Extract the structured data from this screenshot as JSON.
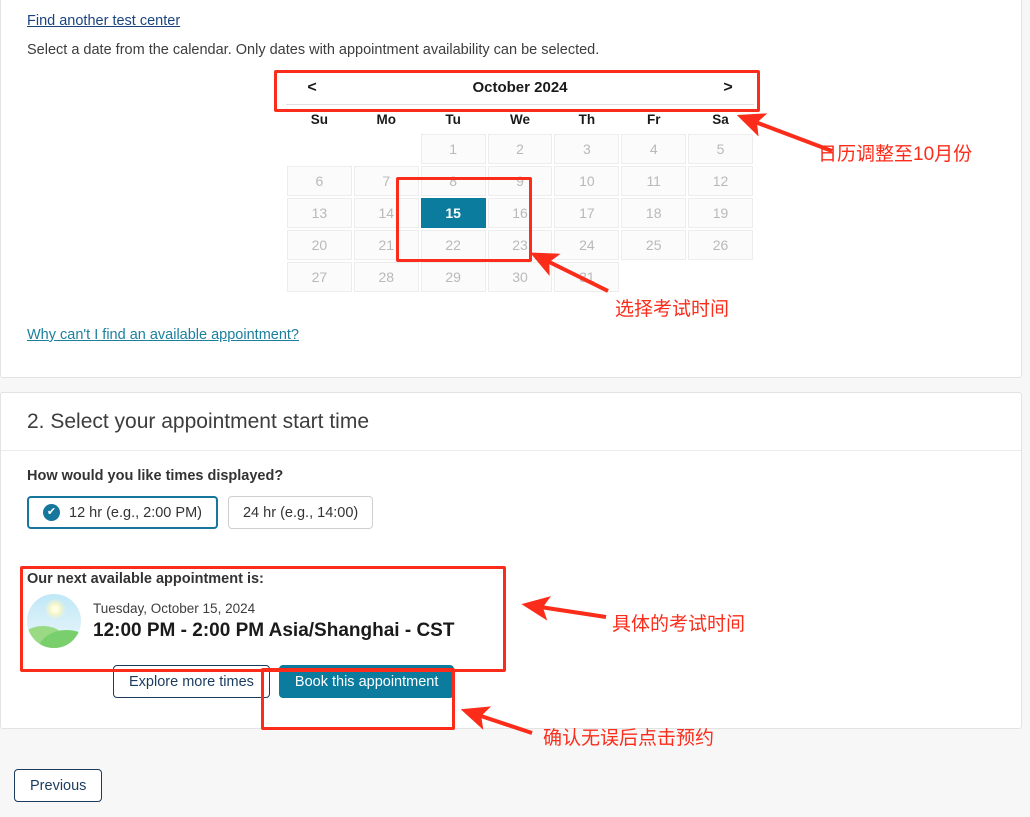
{
  "page": {
    "top_link": "Find another test center",
    "instructions": "Select a date from the calendar. Only dates with appointment availability can be selected.",
    "why_link": "Why can't I find an available appointment?",
    "previous_label": "Previous"
  },
  "calendar": {
    "prev_label": "<",
    "next_label": ">",
    "title": "October 2024",
    "weekdays": [
      "Su",
      "Mo",
      "Tu",
      "We",
      "Th",
      "Fr",
      "Sa"
    ],
    "leading_blanks": 2,
    "days": [
      1,
      2,
      3,
      4,
      5,
      6,
      7,
      8,
      9,
      10,
      11,
      12,
      13,
      14,
      15,
      16,
      17,
      18,
      19,
      20,
      21,
      22,
      23,
      24,
      25,
      26,
      27,
      28,
      29,
      30,
      31
    ],
    "selected_day": 15,
    "selected_color": "#0b7b9e",
    "disabled_color": "#b9b9b9"
  },
  "section_two": {
    "title": "2. Select your appointment start time",
    "question": "How would you like times displayed?",
    "format_options": [
      {
        "label": "12 hr (e.g., 2:00 PM)",
        "selected": true
      },
      {
        "label": "24 hr (e.g., 14:00)",
        "selected": false
      }
    ],
    "check_glyph": "✔",
    "appointment": {
      "heading": "Our next available appointment is:",
      "date": "Tuesday, October 15, 2024",
      "time": "12:00 PM - 2:00 PM Asia/Shanghai - CST"
    },
    "actions": {
      "explore": "Explore more times",
      "book": "Book this appointment"
    }
  },
  "annotations": {
    "color": "#fb2c1a",
    "notes": [
      {
        "text": "日历调整至10月份"
      },
      {
        "text": "选择考试时间"
      },
      {
        "text": "具体的考试时间"
      },
      {
        "text": "确认无误后点击预约"
      }
    ]
  }
}
